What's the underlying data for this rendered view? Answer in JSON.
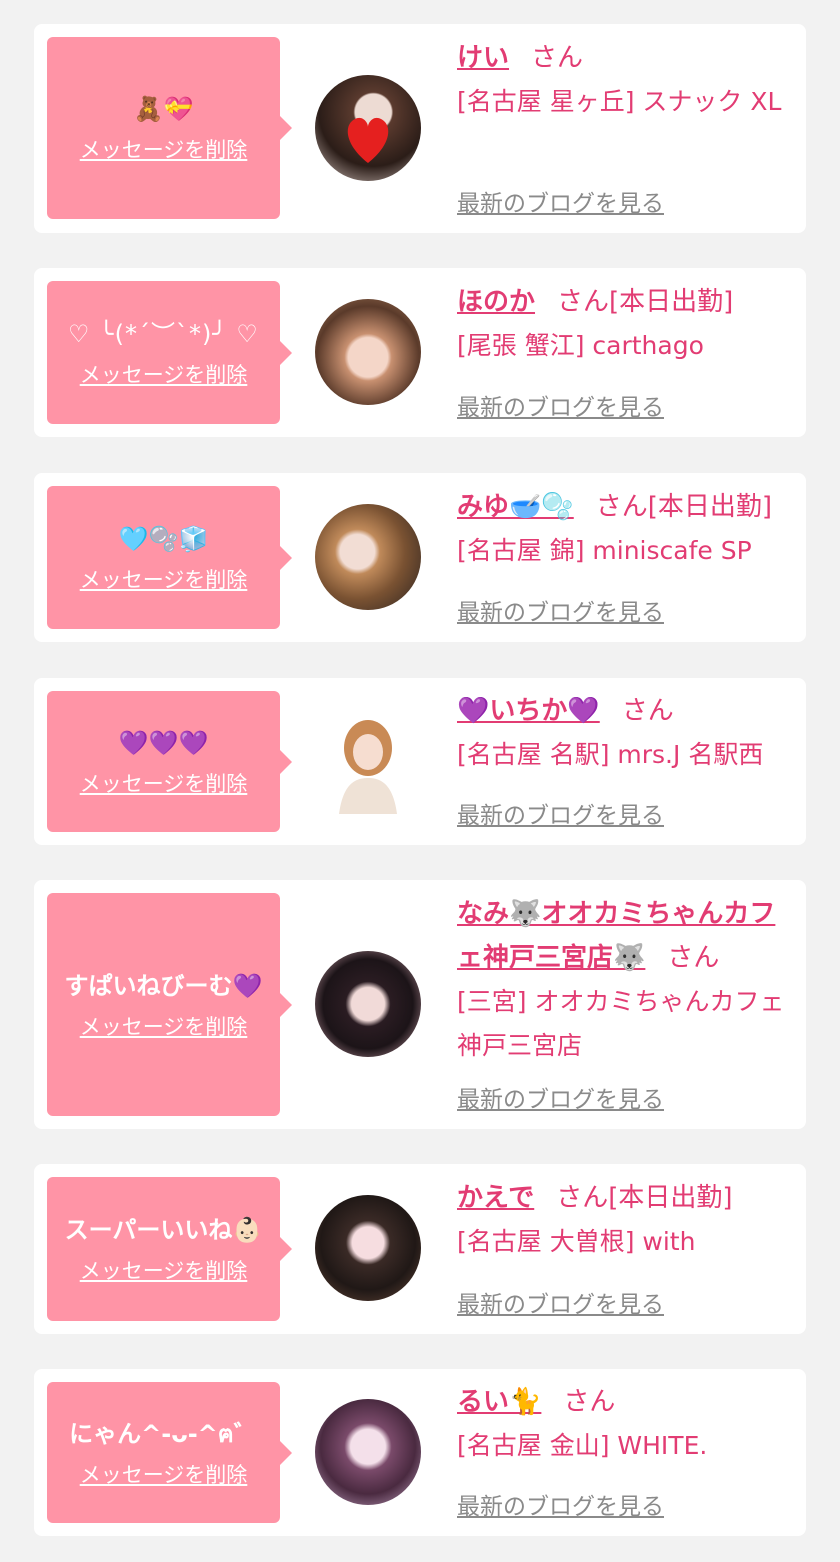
{
  "delete_label": "メッセージを削除",
  "blog_label": "最新のブログを見る",
  "san_label": "さん",
  "colors": {
    "background": "#f2f2f2",
    "bubble": "#ff94a6",
    "name": "#e23c73",
    "link_gray": "#8a8a8a"
  },
  "items": [
    {
      "message": "🧸💝",
      "name": "けい",
      "suffix": "",
      "shop": "[名古屋 星ヶ丘] スナック XL"
    },
    {
      "message": "♡ ╰(*´︶`*)╯ ♡",
      "name": "ほのか",
      "suffix": "[本日出勤]",
      "shop": "[尾張 蟹江] carthago"
    },
    {
      "message": "🩵🫧🧊",
      "name": "みゆ🥣🫧",
      "suffix": "[本日出勤]",
      "shop": "[名古屋 錦] miniscafe SP"
    },
    {
      "message": "💜💜💜",
      "name": "💜いちか💜",
      "suffix": "",
      "shop": "[名古屋 名駅] mrs.J 名駅西"
    },
    {
      "message": "すぱいねびーむ💜",
      "name": "なみ🐺オオカミちゃんカフェ神戸三宮店🐺",
      "suffix": "",
      "shop": "[三宮] オオカミちゃんカフェ神戸三宮店"
    },
    {
      "message": "スーパーいいね👶🏻",
      "name": "かえで",
      "suffix": "[本日出勤]",
      "shop": "[名古屋 大曽根] with"
    },
    {
      "message": "にゃん^-ᴗ-^ฅ゛",
      "name": "るい🐈",
      "suffix": "",
      "shop": "[名古屋 金山] WHITE."
    }
  ]
}
